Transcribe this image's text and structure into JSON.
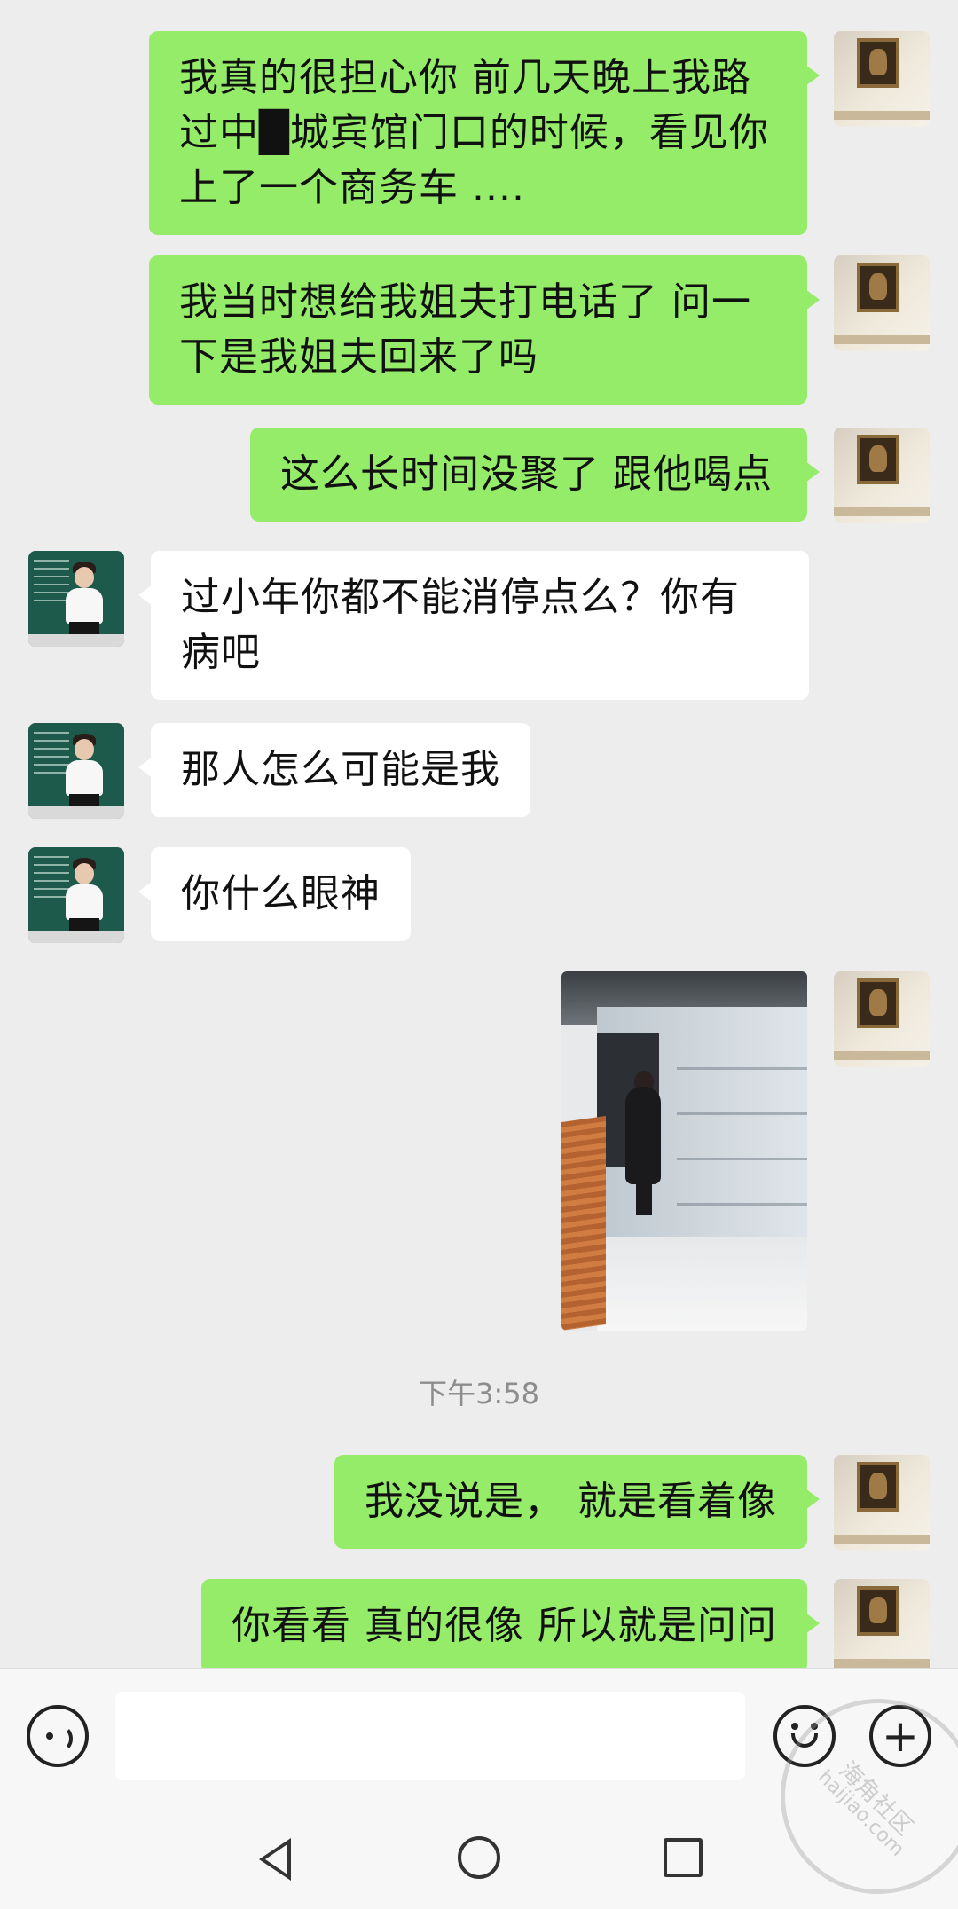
{
  "messages": [
    {
      "sender": "self",
      "text": "我真的很担心你 前几天晚上我路过中█城宾馆门口的时候，看见你上了一个商务车 ...."
    },
    {
      "sender": "self",
      "text": "我当时想给我姐夫打电话了 问一下是我姐夫回来了吗"
    },
    {
      "sender": "self",
      "text": "这么长时间没聚了 跟他喝点"
    },
    {
      "sender": "other",
      "text": "过小年你都不能消停点么？你有病吧"
    },
    {
      "sender": "other",
      "text": "那人怎么可能是我"
    },
    {
      "sender": "other",
      "text": "你什么眼神"
    },
    {
      "sender": "self",
      "type": "image"
    },
    {
      "sender": "self",
      "text": "我没说是， 就是看着像"
    },
    {
      "sender": "self",
      "text": "你看看 真的很像 所以就是问问"
    }
  ],
  "timestamp": "下午3:58",
  "input_bar": {
    "voice_icon": "voice-icon",
    "text_value": "",
    "emoji_icon": "emoji-icon",
    "plus_icon": "plus-icon",
    "plus_symbol": "+"
  },
  "nav": {
    "back_icon": "back-triangle-icon",
    "home_icon": "home-circle-icon",
    "recent_icon": "recent-square-icon"
  },
  "watermark": {
    "title": "海角社区",
    "url": "haijiao.com"
  },
  "colors": {
    "self_bubble": "#95ec69",
    "other_bubble": "#ffffff",
    "background": "#ededed"
  }
}
